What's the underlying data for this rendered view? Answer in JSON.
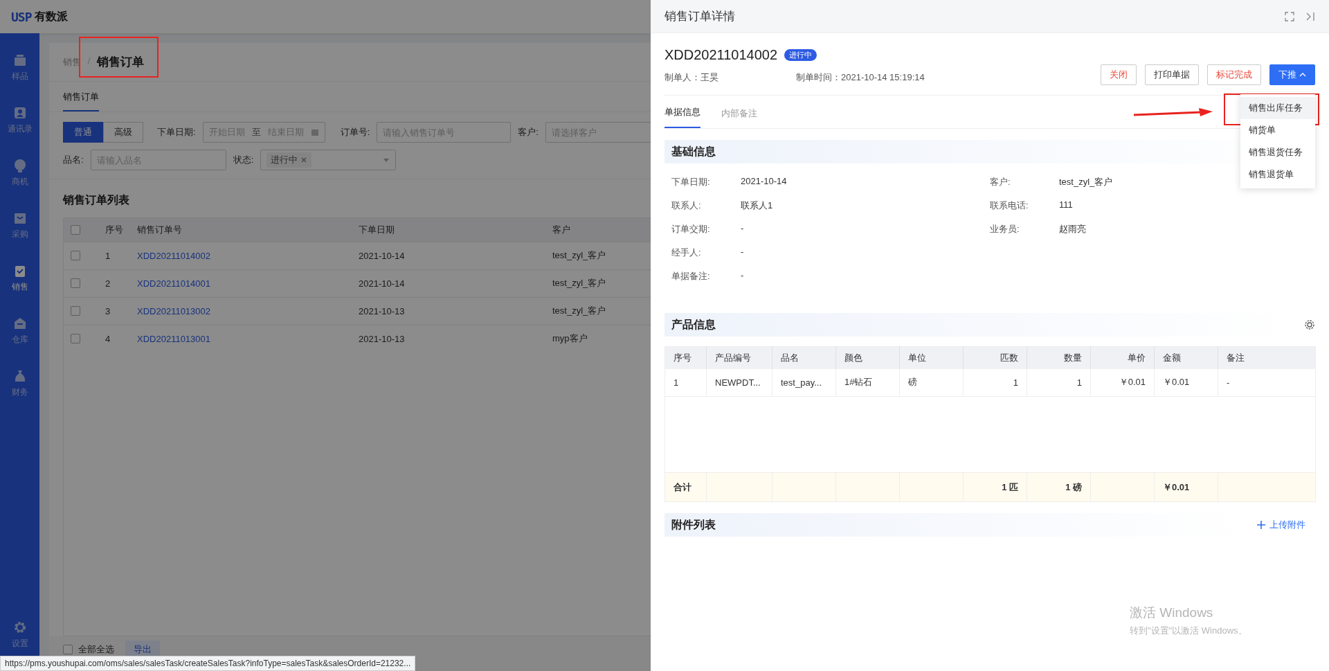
{
  "app": {
    "logo_mark": "USP",
    "logo_text": "有数派"
  },
  "sidebar": {
    "items": [
      {
        "label": "样品",
        "selected": false
      },
      {
        "label": "通讯录",
        "selected": false
      },
      {
        "label": "商机",
        "selected": false
      },
      {
        "label": "采购",
        "selected": false
      },
      {
        "label": "销售",
        "selected": true
      },
      {
        "label": "仓库",
        "selected": false
      },
      {
        "label": "财务",
        "selected": false
      }
    ],
    "settings": {
      "label": "设置",
      "selected": false
    }
  },
  "breadcrumb": [
    "销售",
    "销售订单"
  ],
  "page_tabs": [
    {
      "label": "销售订单",
      "selected": true
    }
  ],
  "filters": {
    "modes": [
      {
        "label": "普通",
        "selected": true
      },
      {
        "label": "高级",
        "selected": false
      }
    ],
    "date_range": {
      "label": "下单日期:",
      "start_placeholder": "开始日期",
      "separator": "至",
      "end_placeholder": "结束日期"
    },
    "order_no": {
      "label": "订单号:",
      "placeholder": "请输入销售订单号"
    },
    "customer": {
      "label": "客户:",
      "placeholder": "请选择客户"
    },
    "product_name": {
      "label": "品名:",
      "placeholder": "请输入品名"
    },
    "status": {
      "label": "状态:",
      "tags": [
        "进行中"
      ]
    }
  },
  "list": {
    "title": "销售订单列表",
    "all_checked": false,
    "columns": [
      "序号",
      "销售订单号",
      "下单日期",
      "客户"
    ],
    "rows": [
      {
        "selected": false,
        "seq": "1",
        "order_no": "XDD20211014002",
        "date": "2021-10-14",
        "customer": "test_zyl_客户"
      },
      {
        "selected": false,
        "seq": "2",
        "order_no": "XDD20211014001",
        "date": "2021-10-14",
        "customer": "test_zyl_客户"
      },
      {
        "selected": false,
        "seq": "3",
        "order_no": "XDD20211013002",
        "date": "2021-10-13",
        "customer": "test_zyl_客户"
      },
      {
        "selected": false,
        "seq": "4",
        "order_no": "XDD20211013001",
        "date": "2021-10-13",
        "customer": "myp客户"
      }
    ]
  },
  "footer": {
    "select_all": {
      "label": "全部全选",
      "checked": false
    },
    "export_button": "导出"
  },
  "status_url": "https://pms.youshupai.com/oms/sales/salesTask/createSalesTask?infoType=salesTask&salesOrderId=21232...",
  "drawer": {
    "title": "销售订单详情",
    "order_no": "XDD20211014002",
    "status_badge": "进行中",
    "creator_label": "制单人：",
    "creator": "王昊",
    "time_label": "制单时间：",
    "time": "2021-10-14 15:19:14",
    "buttons": [
      {
        "label": "关闭",
        "kind": "danger"
      },
      {
        "label": "打印单据",
        "kind": "default"
      },
      {
        "label": "标记完成",
        "kind": "danger"
      },
      {
        "label": "下推",
        "kind": "dropdown"
      }
    ],
    "push_menu": [
      {
        "label": "销售出库任务",
        "highlighted": true
      },
      {
        "label": "销货单",
        "highlighted": false
      },
      {
        "label": "销售退货任务",
        "highlighted": false
      },
      {
        "label": "销售退货单",
        "highlighted": false
      }
    ],
    "tabs": [
      {
        "label": "单据信息",
        "selected": true
      },
      {
        "label": "内部备注",
        "selected": false
      }
    ],
    "basic_info": {
      "title": "基础信息",
      "rows": [
        [
          {
            "label": "下单日期:",
            "value": "2021-10-14"
          },
          {
            "label": "客户:",
            "value": "test_zyl_客户"
          }
        ],
        [
          {
            "label": "联系人:",
            "value": "联系人1"
          },
          {
            "label": "联系电话:",
            "value": "111"
          }
        ],
        [
          {
            "label": "订单交期:",
            "value": "-"
          },
          {
            "label": "业务员:",
            "value": "赵雨亮"
          }
        ],
        [
          {
            "label": "经手人:",
            "value": "-"
          }
        ],
        [
          {
            "label": "单据备注:",
            "value": "-"
          }
        ]
      ]
    },
    "products": {
      "title": "产品信息",
      "columns": [
        {
          "label": "序号",
          "kind": "text"
        },
        {
          "label": "产品编号",
          "kind": "text"
        },
        {
          "label": "品名",
          "kind": "text"
        },
        {
          "label": "颜色",
          "kind": "text"
        },
        {
          "label": "单位",
          "kind": "text"
        },
        {
          "label": "匹数",
          "kind": "number"
        },
        {
          "label": "数量",
          "kind": "number"
        },
        {
          "label": "单价",
          "kind": "number"
        },
        {
          "label": "金额",
          "kind": "text"
        },
        {
          "label": "备注",
          "kind": "text"
        }
      ],
      "rows": [
        [
          "1",
          "NEWPDT...",
          "test_pay...",
          "1#钻石",
          "磅",
          "1",
          "1",
          "￥0.01",
          "￥0.01",
          "-"
        ]
      ],
      "totals": {
        "label": "合计",
        "pieces": "1 匹",
        "quantity": "1 磅",
        "amount": "￥0.01"
      }
    },
    "attachments": {
      "title": "附件列表",
      "upload": "上传附件"
    }
  },
  "activation_notice": {
    "title": "激活 Windows",
    "subtitle": "转到\"设置\"以激活 Windows。"
  }
}
